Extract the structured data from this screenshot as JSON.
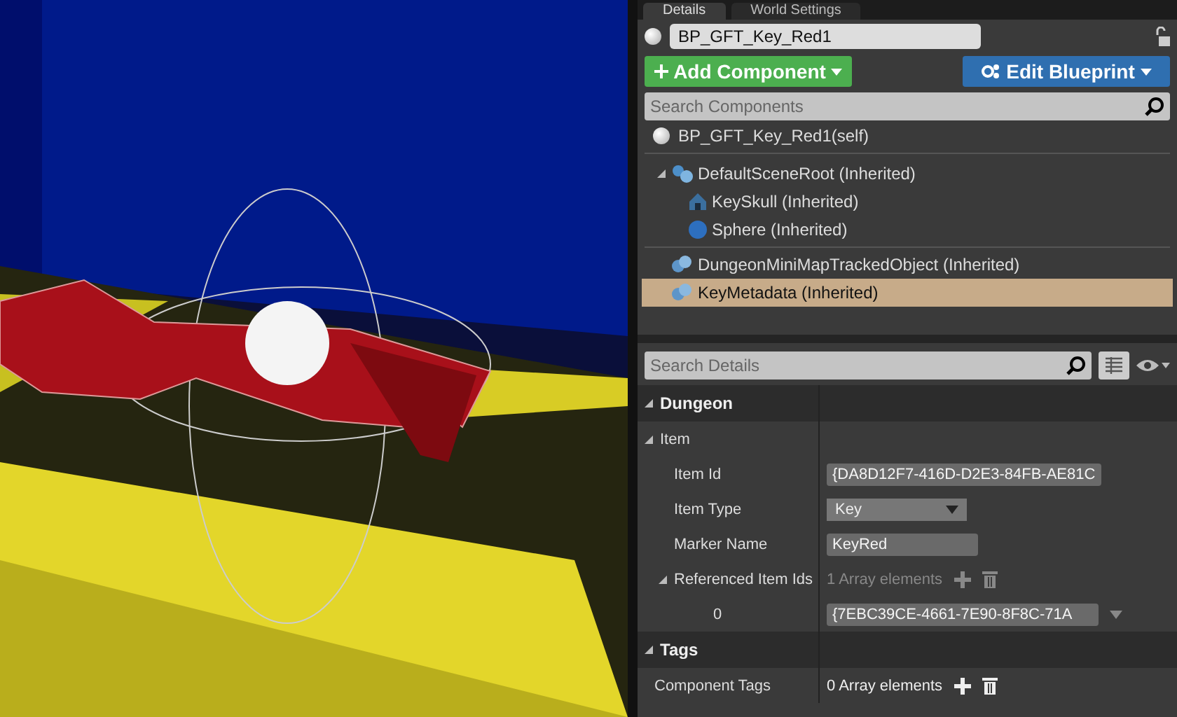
{
  "tabs": [
    {
      "label": "Details",
      "selected": true
    },
    {
      "label": "World Settings",
      "selected": false
    }
  ],
  "actor_name": {
    "value": "BP_GFT_Key_Red1"
  },
  "add_component_button": {
    "label": "Add Component"
  },
  "edit_blueprint_button": {
    "label": "Edit Blueprint"
  },
  "component_search": {
    "placeholder": "Search Components"
  },
  "self_item": {
    "label": "BP_GFT_Key_Red1(self)"
  },
  "components": [
    {
      "label": "DefaultSceneRoot (Inherited)",
      "kind": "scene",
      "expanded": true,
      "selected": false,
      "children": [
        {
          "label": "KeySkull (Inherited)",
          "kind": "mesh",
          "selected": false
        },
        {
          "label": "Sphere (Inherited)",
          "kind": "sphere",
          "selected": false
        }
      ]
    },
    {
      "label": "DungeonMiniMapTrackedObject (Inherited)",
      "kind": "component",
      "selected": false
    },
    {
      "label": "KeyMetadata (Inherited)",
      "kind": "component",
      "selected": true
    }
  ],
  "details_search": {
    "placeholder": "Search Details"
  },
  "categories": [
    {
      "title": "Dungeon",
      "expanded": true,
      "groups": [
        {
          "title": "Item",
          "expanded": true,
          "properties": [
            {
              "name": "Item Id",
              "kind": "text",
              "value": "{DA8D12F7-416D-D2E3-84FB-AE81C"
            },
            {
              "name": "Item Type",
              "kind": "combo",
              "value": "Key"
            },
            {
              "name": "Marker Name",
              "kind": "text",
              "value": "KeyRed"
            },
            {
              "name": "Referenced Item Ids",
              "kind": "array",
              "value": "1 Array elements",
              "disabled": true,
              "expanded": true,
              "children": [
                {
                  "name": "0",
                  "kind": "guid",
                  "value": "{7EBC39CE-4661-7E90-8F8C-71A"
                }
              ]
            }
          ]
        }
      ]
    },
    {
      "title": "Tags",
      "expanded": true,
      "groups": [
        {
          "properties": [
            {
              "name": "Component Tags",
              "kind": "array",
              "value": "0 Array elements",
              "disabled": false
            }
          ]
        }
      ]
    }
  ]
}
